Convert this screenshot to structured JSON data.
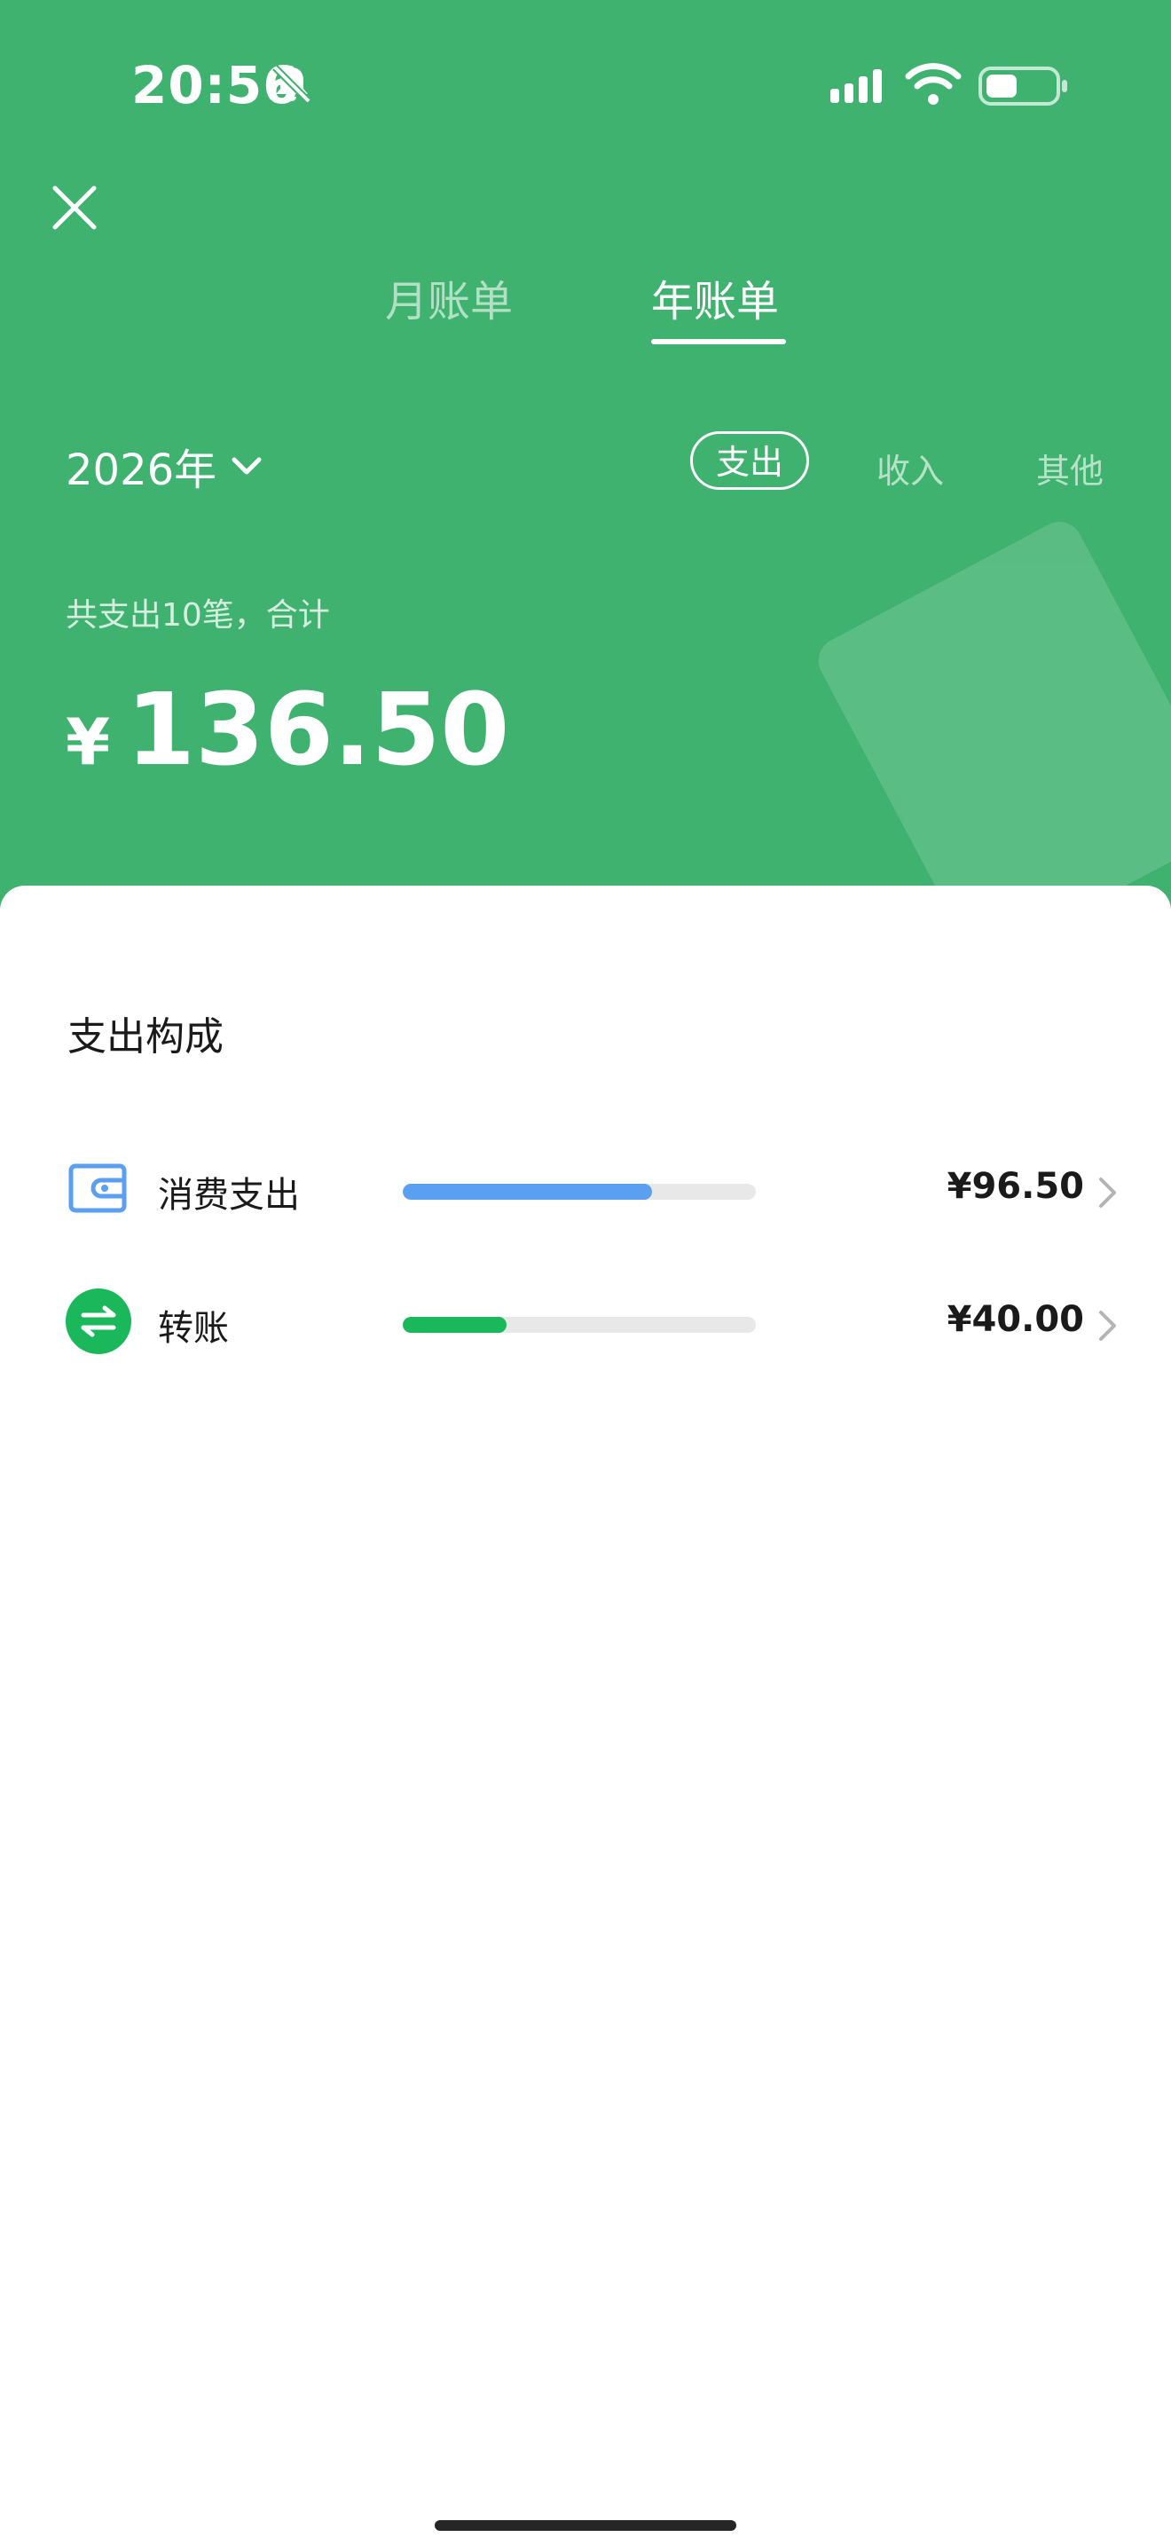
{
  "status_bar": {
    "time": "20:56"
  },
  "top_tabs": {
    "monthly": "月账单",
    "yearly": "年账单",
    "active": "yearly"
  },
  "year_selector": {
    "label": "2026年"
  },
  "category_tabs": {
    "expense": "支出",
    "income": "收入",
    "other": "其他",
    "active": "expense"
  },
  "summary": {
    "text": "共支出10笔，合计",
    "currency": "¥",
    "total": "136.50"
  },
  "breakdown": {
    "title": "支出构成",
    "items": [
      {
        "label": "消费支出",
        "amount": "¥96.50",
        "share": 0.707,
        "color": "#5a9ff0",
        "icon": "wallet-icon"
      },
      {
        "label": "转账",
        "amount": "¥40.00",
        "share": 0.293,
        "color": "#1ab85a",
        "icon": "transfer-icon"
      }
    ]
  },
  "colors": {
    "header_bg": "#3fb26f",
    "accent_blue": "#5a9ff0",
    "accent_green": "#1ab85a"
  }
}
